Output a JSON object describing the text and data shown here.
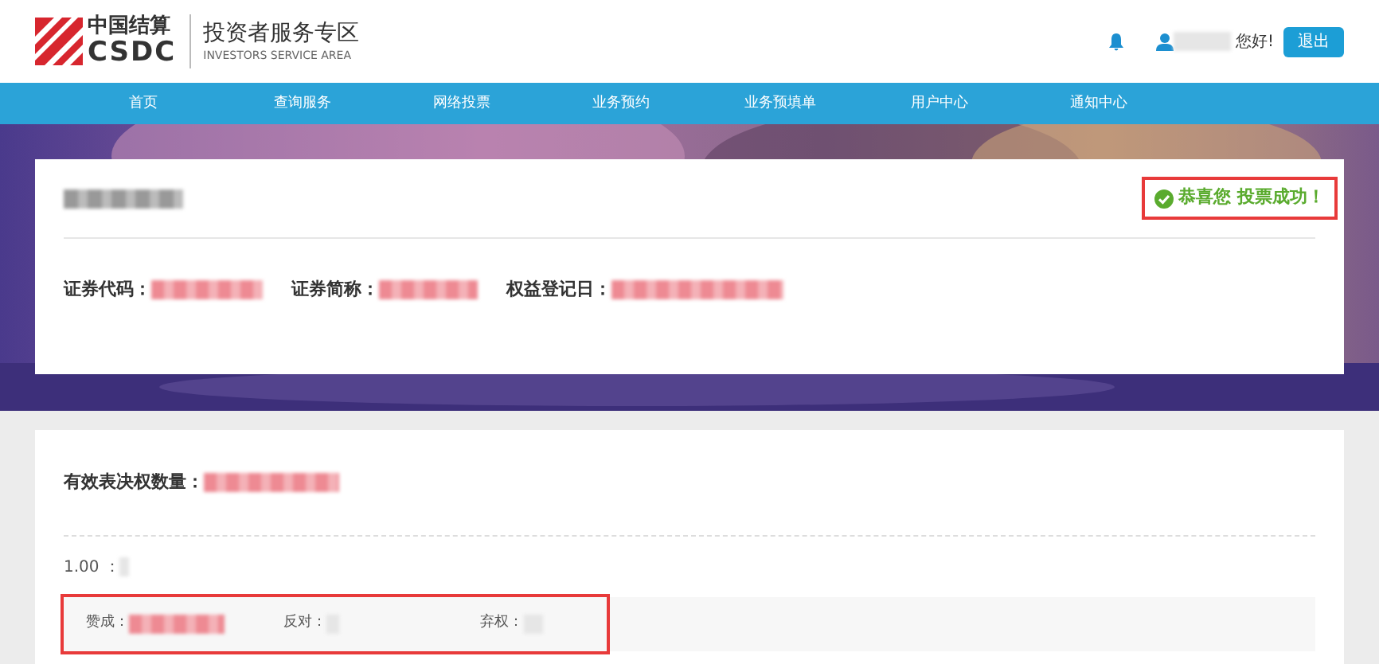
{
  "header": {
    "logo_cn": "中国结算",
    "logo_en": "CSDC",
    "area_title": "投资者服务专区",
    "area_subtitle": "INVESTORS SERVICE AREA",
    "greeting": "您好!",
    "logout": "退出"
  },
  "nav": [
    {
      "label": "首页"
    },
    {
      "label": "查询服务"
    },
    {
      "label": "网络投票"
    },
    {
      "label": "业务预约"
    },
    {
      "label": "业务预填单"
    },
    {
      "label": "用户中心"
    },
    {
      "label": "通知中心"
    }
  ],
  "result": {
    "message": "恭喜您 投票成功！",
    "fields": [
      {
        "label": "证券代码："
      },
      {
        "label": "证券简称："
      },
      {
        "label": "权益登记日："
      }
    ]
  },
  "votes": {
    "title": "有效表决权数量：",
    "proposal": "1.00 ：",
    "options": [
      {
        "label": "赞成："
      },
      {
        "label": "反对："
      },
      {
        "label": "弃权："
      }
    ]
  }
}
